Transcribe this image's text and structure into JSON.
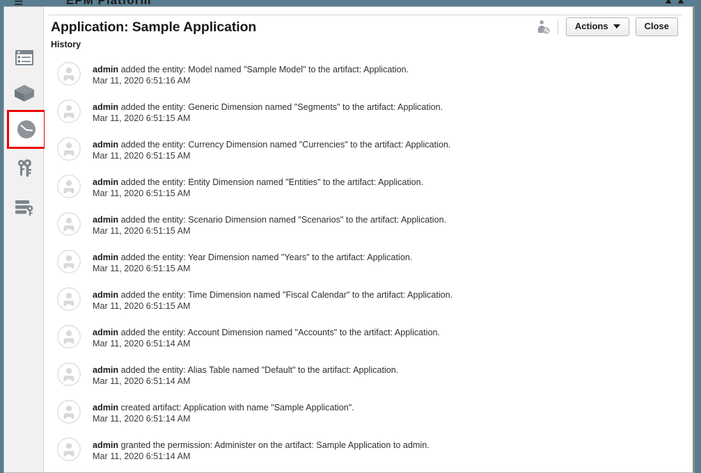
{
  "backdrop": {
    "menu_hint": "☰",
    "title_hint": "EPM Platform",
    "right_hint": "▲  ▲"
  },
  "header": {
    "title": "Application: Sample Application",
    "section_label": "History",
    "user_badge_icon": "user-with-badge-icon",
    "actions_label": "Actions",
    "actions_caret_icon": "caret-down-icon",
    "close_label": "Close"
  },
  "sidebar": {
    "items": [
      {
        "name": "sidebar-item-dimensions-list",
        "icon": "list-panel-icon",
        "selected": false
      },
      {
        "name": "sidebar-item-cube",
        "icon": "cube-icon",
        "selected": false
      },
      {
        "name": "sidebar-item-history",
        "icon": "clock-icon",
        "selected": true
      },
      {
        "name": "sidebar-item-permissions",
        "icon": "keys-icon",
        "selected": false
      },
      {
        "name": "sidebar-item-database-access",
        "icon": "database-key-icon",
        "selected": false
      }
    ]
  },
  "history": {
    "entries": [
      {
        "actor": "admin",
        "text": " added the entity: Model named \"Sample Model\" to the artifact: Application.",
        "timestamp": "Mar 11, 2020 6:51:16 AM"
      },
      {
        "actor": "admin",
        "text": " added the entity: Generic Dimension named \"Segments\" to the artifact: Application.",
        "timestamp": "Mar 11, 2020 6:51:15 AM"
      },
      {
        "actor": "admin",
        "text": " added the entity: Currency Dimension named \"Currencies\" to the artifact: Application.",
        "timestamp": "Mar 11, 2020 6:51:15 AM"
      },
      {
        "actor": "admin",
        "text": " added the entity: Entity Dimension named \"Entities\" to the artifact: Application.",
        "timestamp": "Mar 11, 2020 6:51:15 AM"
      },
      {
        "actor": "admin",
        "text": " added the entity: Scenario Dimension named \"Scenarios\" to the artifact: Application.",
        "timestamp": "Mar 11, 2020 6:51:15 AM"
      },
      {
        "actor": "admin",
        "text": " added the entity: Year Dimension named \"Years\" to the artifact: Application.",
        "timestamp": "Mar 11, 2020 6:51:15 AM"
      },
      {
        "actor": "admin",
        "text": " added the entity: Time Dimension named \"Fiscal Calendar\" to the artifact: Application.",
        "timestamp": "Mar 11, 2020 6:51:15 AM"
      },
      {
        "actor": "admin",
        "text": " added the entity: Account Dimension named \"Accounts\" to the artifact: Application.",
        "timestamp": "Mar 11, 2020 6:51:14 AM"
      },
      {
        "actor": "admin",
        "text": " added the entity: Alias Table named \"Default\" to the artifact: Application.",
        "timestamp": "Mar 11, 2020 6:51:14 AM"
      },
      {
        "actor": "admin",
        "text": " created artifact: Application with name \"Sample Application\".",
        "timestamp": "Mar 11, 2020 6:51:14 AM"
      },
      {
        "actor": "admin",
        "text": " granted the permission: Administer on the artifact: Sample Application to admin.",
        "timestamp": "Mar 11, 2020 6:51:14 AM"
      }
    ]
  },
  "colors": {
    "backdrop": "#587d8f",
    "rail_background": "#f1f1f1",
    "selection_highlight": "#ee0000",
    "icon_gray": "#7b848c",
    "avatar_gray": "#d6d6d6"
  }
}
